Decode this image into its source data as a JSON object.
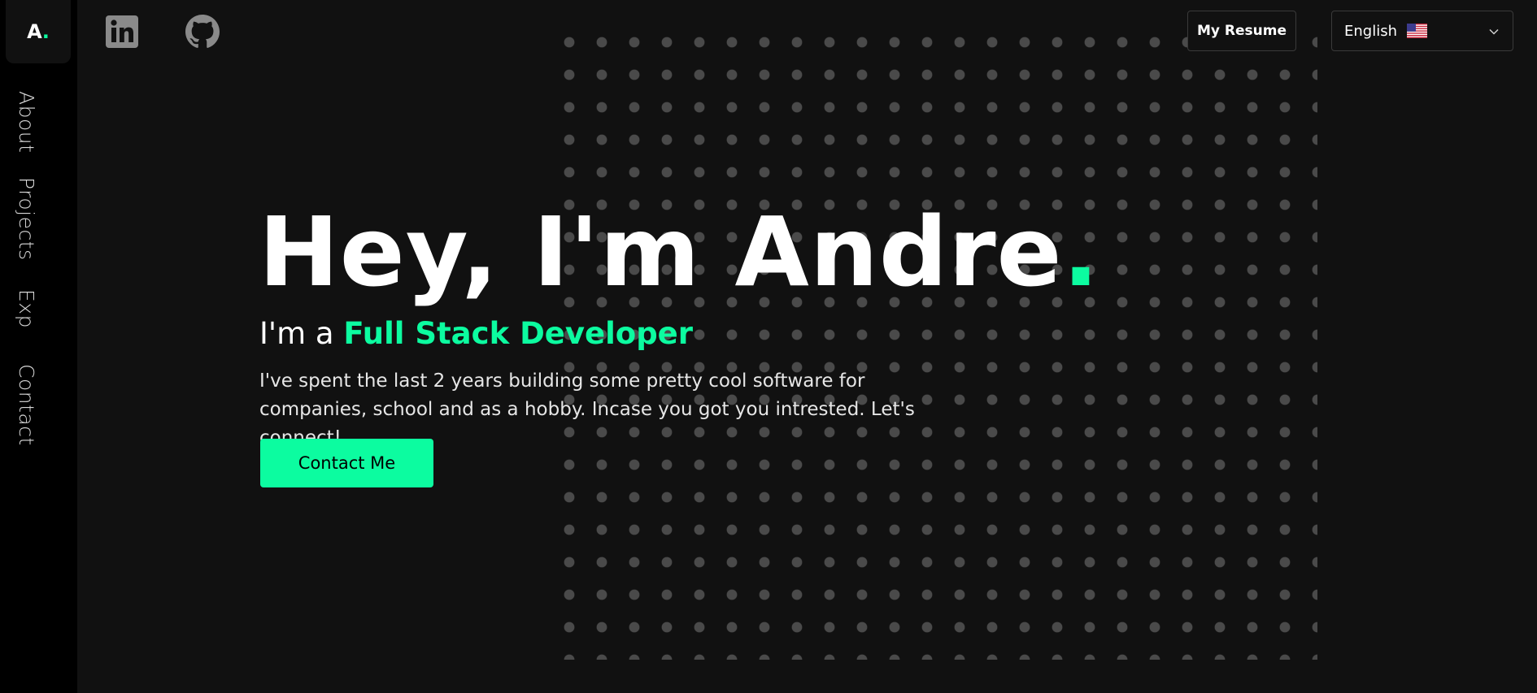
{
  "sidebar": {
    "logo_letter": "A",
    "logo_dot": ".",
    "items": [
      {
        "label": "About"
      },
      {
        "label": "Projects"
      },
      {
        "label": "Exp"
      },
      {
        "label": "Contact"
      }
    ]
  },
  "top_icons": [
    "linkedin-icon",
    "github-icon"
  ],
  "header": {
    "resume_label": "My Resume",
    "language_label": "English",
    "language_flag_icon": "us-flag-icon"
  },
  "hero": {
    "title": "Hey, I'm Andre",
    "title_dot": ".",
    "subtitle_prefix": "I'm a ",
    "subtitle_role": "Full Stack Developer",
    "description": "I've spent the last 2 years building some pretty cool software for companies, school and as a hobby. Incase you got you intrested. Let's connect!",
    "cta_label": "Contact Me"
  },
  "colors": {
    "accent": "#0cfca0",
    "background": "#111111",
    "sidebar": "#000000",
    "grid_dot": "#4a4a4a"
  }
}
